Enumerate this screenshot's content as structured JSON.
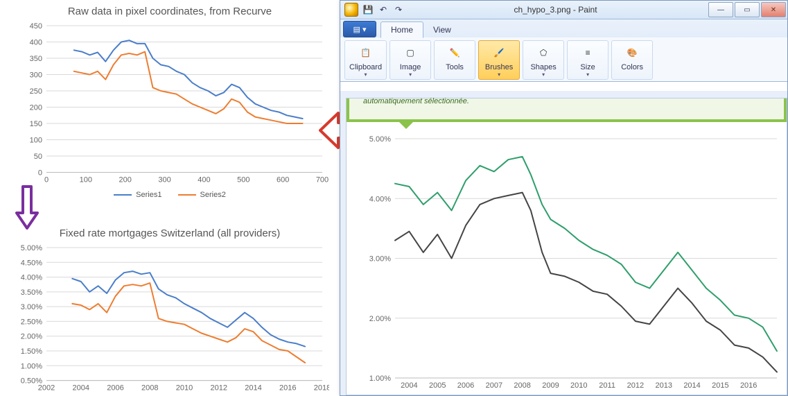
{
  "left": {
    "chart1": {
      "title": "Raw data in pixel coordinates, from Recurve",
      "legend": {
        "s1": "Series1",
        "s2": "Series2"
      }
    },
    "chart2": {
      "title": "Fixed rate mortgages Switzerland (all providers)"
    }
  },
  "paint": {
    "title": "ch_hypo_3.png - Paint",
    "tabs": {
      "home": "Home",
      "view": "View"
    },
    "groups": {
      "clipboard": "Clipboard",
      "image": "Image",
      "tools": "Tools",
      "brushes": "Brushes",
      "shapes": "Shapes",
      "size": "Size",
      "colors": "Colors"
    },
    "banner": "automatiquement sélectionnée."
  },
  "chart_data": [
    {
      "id": "chart1",
      "type": "line",
      "title": "Raw data in pixel coordinates, from Recurve",
      "xlabel": "",
      "ylabel": "",
      "xlim": [
        0,
        700
      ],
      "ylim": [
        0,
        450
      ],
      "xticks": [
        0,
        100,
        200,
        300,
        400,
        500,
        600,
        700
      ],
      "yticks": [
        0,
        50,
        100,
        150,
        200,
        250,
        300,
        350,
        400,
        450
      ],
      "series": [
        {
          "name": "Series1",
          "color": "#4a7ec9",
          "x": [
            70,
            90,
            110,
            130,
            150,
            170,
            190,
            210,
            230,
            250,
            270,
            290,
            310,
            330,
            350,
            370,
            390,
            410,
            430,
            450,
            470,
            490,
            510,
            530,
            550,
            570,
            590,
            610,
            630,
            650
          ],
          "y": [
            375,
            370,
            360,
            368,
            340,
            375,
            400,
            405,
            395,
            395,
            350,
            330,
            325,
            310,
            300,
            275,
            260,
            250,
            235,
            245,
            270,
            260,
            230,
            210,
            200,
            190,
            185,
            175,
            170,
            165
          ]
        },
        {
          "name": "Series2",
          "color": "#ed7d31",
          "x": [
            70,
            90,
            110,
            130,
            150,
            170,
            190,
            210,
            230,
            250,
            270,
            290,
            310,
            330,
            350,
            370,
            390,
            410,
            430,
            450,
            470,
            490,
            510,
            530,
            550,
            570,
            590,
            610,
            630,
            650
          ],
          "y": [
            310,
            305,
            300,
            310,
            285,
            330,
            360,
            365,
            360,
            370,
            260,
            250,
            245,
            240,
            225,
            210,
            200,
            190,
            180,
            195,
            225,
            215,
            185,
            170,
            165,
            160,
            155,
            150,
            150,
            150
          ]
        }
      ]
    },
    {
      "id": "chart2",
      "type": "line",
      "title": "Fixed rate mortgages Switzerland (all providers)",
      "xlabel": "",
      "ylabel": "",
      "xlim": [
        2002,
        2018
      ],
      "ylim": [
        0.005,
        0.05
      ],
      "xticks": [
        2002,
        2004,
        2006,
        2008,
        2010,
        2012,
        2014,
        2016,
        2018
      ],
      "yticks": [
        0.005,
        0.01,
        0.015,
        0.02,
        0.025,
        0.03,
        0.035,
        0.04,
        0.045,
        0.05
      ],
      "ytick_fmt": "pct2",
      "series": [
        {
          "name": "Series1",
          "color": "#4a7ec9",
          "x": [
            2003.5,
            2004,
            2004.5,
            2005,
            2005.5,
            2006,
            2006.5,
            2007,
            2007.5,
            2008,
            2008.5,
            2009,
            2009.5,
            2010,
            2010.5,
            2011,
            2011.5,
            2012,
            2012.5,
            2013,
            2013.5,
            2014,
            2014.5,
            2015,
            2015.5,
            2016,
            2016.5,
            2017
          ],
          "y": [
            0.0395,
            0.0385,
            0.035,
            0.037,
            0.0345,
            0.039,
            0.0415,
            0.042,
            0.041,
            0.0415,
            0.036,
            0.034,
            0.033,
            0.031,
            0.0295,
            0.028,
            0.026,
            0.0245,
            0.023,
            0.0255,
            0.028,
            0.026,
            0.023,
            0.0205,
            0.019,
            0.018,
            0.0175,
            0.0165
          ]
        },
        {
          "name": "Series2",
          "color": "#ed7d31",
          "x": [
            2003.5,
            2004,
            2004.5,
            2005,
            2005.5,
            2006,
            2006.5,
            2007,
            2007.5,
            2008,
            2008.5,
            2009,
            2009.5,
            2010,
            2010.5,
            2011,
            2011.5,
            2012,
            2012.5,
            2013,
            2013.5,
            2014,
            2014.5,
            2015,
            2015.5,
            2016,
            2016.5,
            2017
          ],
          "y": [
            0.031,
            0.0305,
            0.029,
            0.031,
            0.028,
            0.0335,
            0.037,
            0.0375,
            0.037,
            0.038,
            0.026,
            0.025,
            0.0245,
            0.024,
            0.0225,
            0.021,
            0.02,
            0.019,
            0.018,
            0.0195,
            0.0225,
            0.0215,
            0.0185,
            0.017,
            0.0155,
            0.015,
            0.013,
            0.011
          ]
        }
      ]
    },
    {
      "id": "paint_chart",
      "type": "line",
      "title": "",
      "xlabel": "",
      "ylabel": "",
      "xlim": [
        2003.5,
        2017
      ],
      "ylim": [
        0.01,
        0.05
      ],
      "xticks": [
        2004,
        2005,
        2006,
        2007,
        2008,
        2009,
        2010,
        2011,
        2012,
        2013,
        2014,
        2015,
        2016
      ],
      "yticks": [
        0.01,
        0.02,
        0.03,
        0.04,
        0.05
      ],
      "ytick_fmt": "pct2",
      "series": [
        {
          "name": "green",
          "color": "#2e9e6b",
          "x": [
            2003.5,
            2004,
            2004.5,
            2005,
            2005.5,
            2006,
            2006.5,
            2007,
            2007.5,
            2008,
            2008.3,
            2008.7,
            2009,
            2009.5,
            2010,
            2010.5,
            2011,
            2011.5,
            2012,
            2012.5,
            2013,
            2013.5,
            2014,
            2014.5,
            2015,
            2015.5,
            2016,
            2016.5,
            2017
          ],
          "y": [
            0.0425,
            0.042,
            0.039,
            0.041,
            0.038,
            0.043,
            0.0455,
            0.0445,
            0.0465,
            0.047,
            0.044,
            0.039,
            0.0365,
            0.035,
            0.033,
            0.0315,
            0.0305,
            0.029,
            0.026,
            0.025,
            0.028,
            0.031,
            0.028,
            0.025,
            0.023,
            0.0205,
            0.02,
            0.0185,
            0.0145
          ]
        },
        {
          "name": "dark",
          "color": "#444444",
          "x": [
            2003.5,
            2004,
            2004.5,
            2005,
            2005.5,
            2006,
            2006.5,
            2007,
            2007.5,
            2008,
            2008.3,
            2008.7,
            2009,
            2009.5,
            2010,
            2010.5,
            2011,
            2011.5,
            2012,
            2012.5,
            2013,
            2013.5,
            2014,
            2014.5,
            2015,
            2015.5,
            2016,
            2016.5,
            2017
          ],
          "y": [
            0.033,
            0.0345,
            0.031,
            0.034,
            0.03,
            0.0355,
            0.039,
            0.04,
            0.0405,
            0.041,
            0.038,
            0.031,
            0.0275,
            0.027,
            0.026,
            0.0245,
            0.024,
            0.022,
            0.0195,
            0.019,
            0.022,
            0.025,
            0.0225,
            0.0195,
            0.018,
            0.0155,
            0.015,
            0.0135,
            0.011
          ]
        }
      ]
    }
  ]
}
